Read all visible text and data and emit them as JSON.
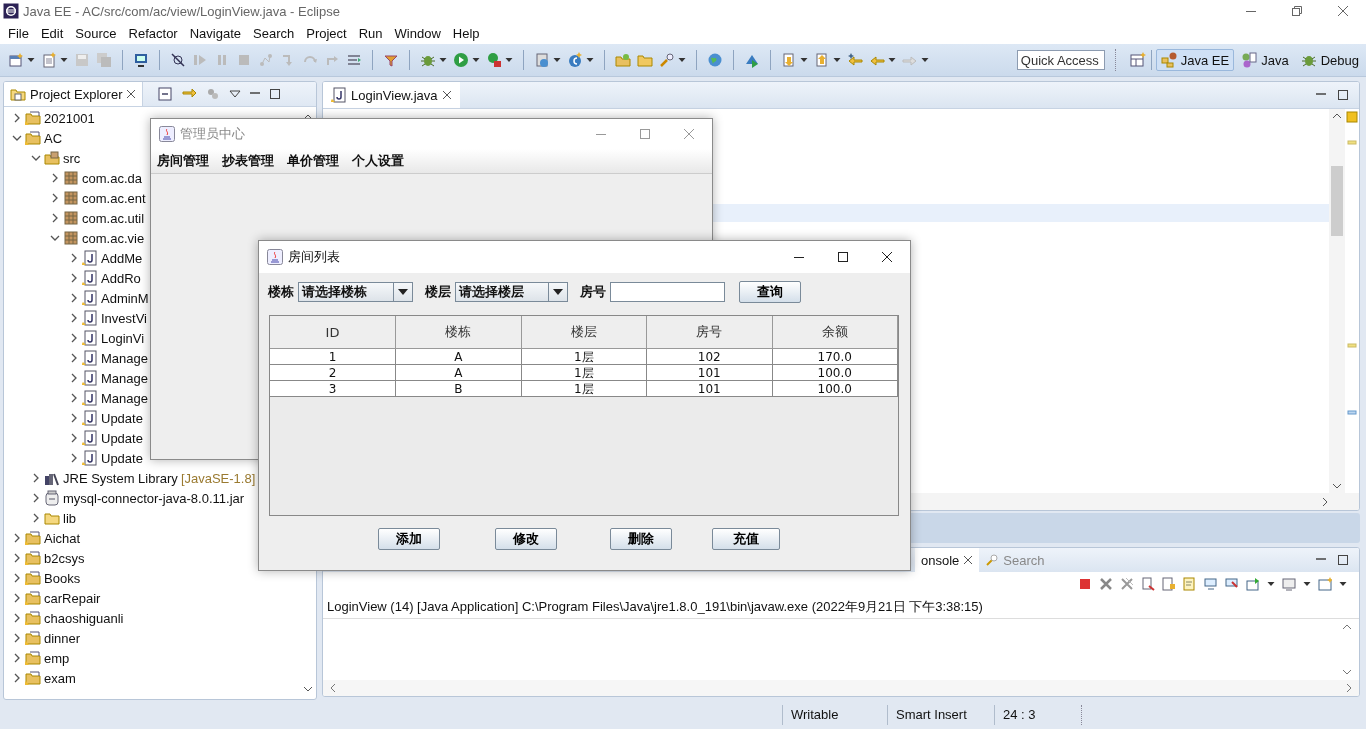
{
  "window": {
    "title": "Java EE - AC/src/com/ac/view/LoginView.java - Eclipse"
  },
  "menu": [
    "File",
    "Edit",
    "Source",
    "Refactor",
    "Navigate",
    "Search",
    "Project",
    "Run",
    "Window",
    "Help"
  ],
  "toolbar": {
    "quick_access": {
      "placeholder": "Quick Access"
    },
    "perspectives": [
      {
        "label": "Java EE",
        "selected": true
      },
      {
        "label": "Java",
        "selected": false
      },
      {
        "label": "Debug",
        "selected": false
      }
    ]
  },
  "project_explorer": {
    "title": "Project Explorer",
    "tree": [
      {
        "label": "2021001",
        "kind": "project",
        "expanded": false
      },
      {
        "label": "AC",
        "kind": "project",
        "expanded": true,
        "children": [
          {
            "label": "src",
            "kind": "src",
            "expanded": true,
            "children": [
              {
                "label": "com.ac.da",
                "kind": "package",
                "expanded": false
              },
              {
                "label": "com.ac.ent",
                "kind": "package",
                "expanded": false
              },
              {
                "label": "com.ac.util",
                "kind": "package",
                "expanded": false
              },
              {
                "label": "com.ac.vie",
                "kind": "package",
                "expanded": true,
                "children": [
                  {
                    "label": "AddMe",
                    "kind": "java",
                    "expanded": false
                  },
                  {
                    "label": "AddRo",
                    "kind": "java",
                    "expanded": false
                  },
                  {
                    "label": "AdminM",
                    "kind": "java",
                    "expanded": false
                  },
                  {
                    "label": "InvestVi",
                    "kind": "java",
                    "expanded": false
                  },
                  {
                    "label": "LoginVi",
                    "kind": "java",
                    "expanded": false
                  },
                  {
                    "label": "Manage",
                    "kind": "java",
                    "expanded": false
                  },
                  {
                    "label": "Manage",
                    "kind": "java",
                    "expanded": false
                  },
                  {
                    "label": "Manage",
                    "kind": "java",
                    "expanded": false
                  },
                  {
                    "label": "Update",
                    "kind": "java",
                    "expanded": false
                  },
                  {
                    "label": "Update",
                    "kind": "java",
                    "expanded": false
                  },
                  {
                    "label": "Update",
                    "kind": "java",
                    "expanded": false
                  }
                ]
              }
            ]
          },
          {
            "label": "JRE System Library",
            "decoration": "[JavaSE-1.8]",
            "kind": "library",
            "expanded": false
          },
          {
            "label": "mysql-connector-java-8.0.11.jar",
            "kind": "jar",
            "expanded": false
          },
          {
            "label": "lib",
            "kind": "folder",
            "expanded": false
          }
        ]
      },
      {
        "label": "Aichat",
        "kind": "project",
        "expanded": false
      },
      {
        "label": "b2csys",
        "kind": "project",
        "expanded": false
      },
      {
        "label": "Books",
        "kind": "project",
        "expanded": false
      },
      {
        "label": "carRepair",
        "kind": "project",
        "expanded": false
      },
      {
        "label": "chaoshiguanli",
        "kind": "project",
        "expanded": false
      },
      {
        "label": "dinner",
        "kind": "project",
        "expanded": false
      },
      {
        "label": "emp",
        "kind": "project",
        "expanded": false
      },
      {
        "label": "exam",
        "kind": "project",
        "expanded": false
      }
    ]
  },
  "editor": {
    "tabs": [
      {
        "label": "LoginView.java",
        "selected": true
      }
    ]
  },
  "console": {
    "tabs": [
      {
        "label": "onsole",
        "selected": true
      },
      {
        "label": "Search",
        "selected": false
      }
    ],
    "lines": [
      "LoginView (14) [Java Application] C:\\Program Files\\Java\\jre1.8.0_191\\bin\\javaw.exe (2022年9月21日 下午3:38:15)"
    ]
  },
  "status_bar": [
    "Writable",
    "Smart Insert",
    "24 : 3"
  ],
  "admin_window": {
    "title": "管理员中心",
    "menu": [
      "房间管理",
      "抄表管理",
      "单价管理",
      "个人设置"
    ]
  },
  "room_window": {
    "title": "房间列表",
    "filters": [
      {
        "kind": "combo",
        "label": "楼栋",
        "value": "请选择楼栋"
      },
      {
        "kind": "combo",
        "label": "楼层",
        "value": "请选择楼层"
      },
      {
        "kind": "text",
        "label": "房号"
      }
    ],
    "query_button": "查询",
    "table": {
      "columns": [
        "ID",
        "楼栋",
        "楼层",
        "房号",
        "余额"
      ],
      "rows": [
        [
          "1",
          "A",
          "1层",
          "102",
          "170.0"
        ],
        [
          "2",
          "A",
          "1层",
          "101",
          "100.0"
        ],
        [
          "3",
          "B",
          "1层",
          "101",
          "100.0"
        ]
      ]
    },
    "buttons": [
      "添加",
      "修改",
      "删除",
      "充值"
    ]
  }
}
